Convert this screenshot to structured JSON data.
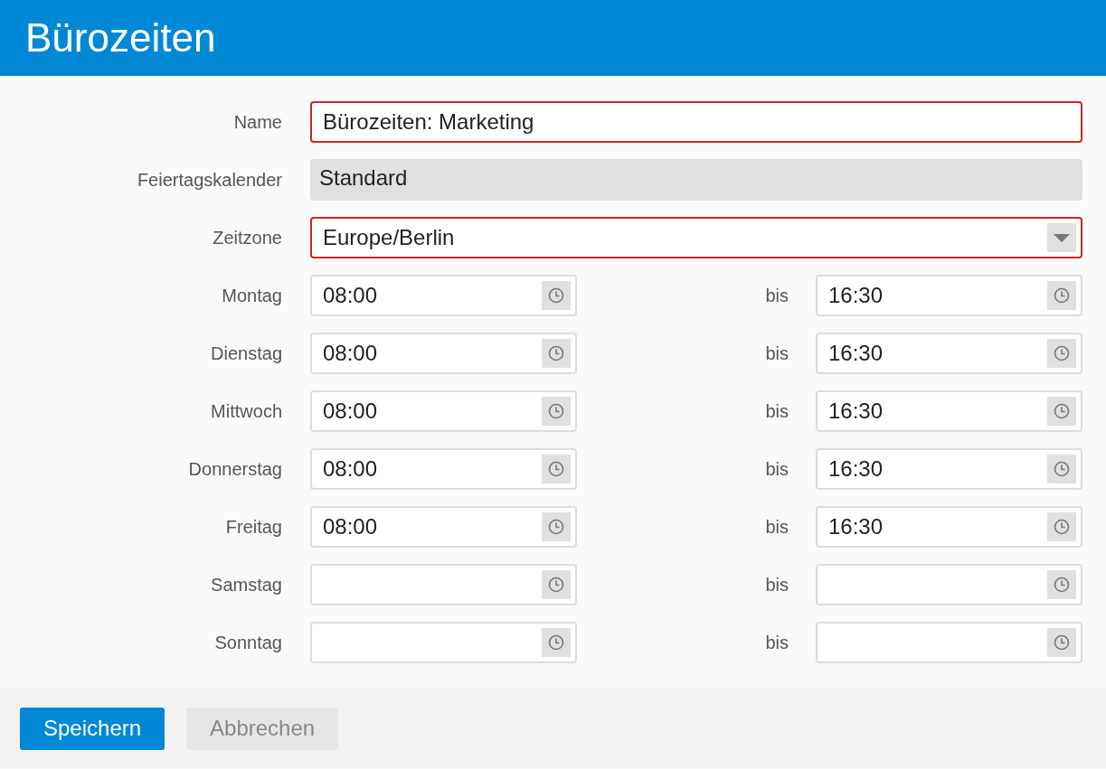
{
  "title": "Bürozeiten",
  "fields": [
    {
      "kind": "text",
      "label": "Name",
      "value": "Bürozeiten: Marketing",
      "invalid": true
    },
    {
      "kind": "readonly",
      "label": "Feiertagskalender",
      "value": "Standard"
    },
    {
      "kind": "select",
      "label": "Zeitzone",
      "value": "Europe/Berlin",
      "invalid": true
    }
  ],
  "days": [
    {
      "label": "Montag",
      "from": "08:00",
      "separator": "bis",
      "to": "16:30"
    },
    {
      "label": "Dienstag",
      "from": "08:00",
      "separator": "bis",
      "to": "16:30"
    },
    {
      "label": "Mittwoch",
      "from": "08:00",
      "separator": "bis",
      "to": "16:30"
    },
    {
      "label": "Donnerstag",
      "from": "08:00",
      "separator": "bis",
      "to": "16:30"
    },
    {
      "label": "Freitag",
      "from": "08:00",
      "separator": "bis",
      "to": "16:30"
    },
    {
      "label": "Samstag",
      "separator": "bis"
    },
    {
      "label": "Sonntag",
      "separator": "bis"
    }
  ],
  "buttons": [
    {
      "label": "Speichern",
      "kind": "primary",
      "disabled": false
    },
    {
      "label": "Abbrechen",
      "kind": "secondary",
      "disabled": true
    }
  ]
}
